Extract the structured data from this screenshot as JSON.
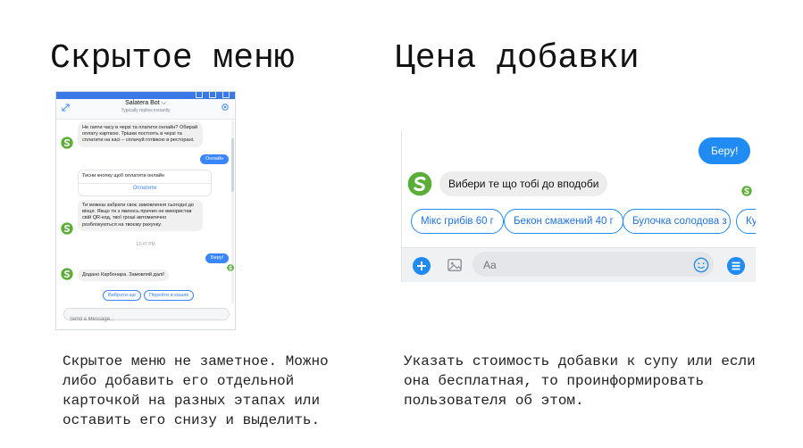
{
  "colors": {
    "accent": "#1f8bf3",
    "bot_logo_green": "#5aae37",
    "bubble_gray": "#f1f0f0"
  },
  "left": {
    "heading": "Скрытое меню",
    "caption": "Скрытое меню не заметное. Можно\nлибо добавить его отдельной\nкарточкой на разных этапах или\nоставить его снизу и выделить.",
    "window": {
      "bot_name": "Salatera Bot ⌵",
      "bot_status": "Typically replies instantly",
      "messages": {
        "m1": "Не гаяти часу в черзі та платити онлайн? Обирай оплату карткою. Трішки постоять в черзі та сплатити на касі – сплачуй готівкою в ресторані.",
        "u1": "Онлайн",
        "card_title": "Тисни кнопку щоб оплатити онлайн",
        "card_link": "Оплатити",
        "m2": "Ти можеш забрати своє замовлення сьогодні до вінця. Якщо ти з якихось причин не використав свій QR-код, твої гроші автоматично розблокуються на твоєму рахунку.",
        "time": "12:47 PM",
        "u2": "Беру!",
        "m3": "Додано Карбонара. Замовляй далі!"
      },
      "quick_replies": [
        "Вибрати ще",
        "Перейти в кошик"
      ],
      "composer_placeholder": "Send a Message..."
    }
  },
  "right": {
    "heading": "Цена добавки",
    "caption": "Указать стоимость добавки к супу или если\nона бесплатная, то проинформировать\nпользователя об этом.",
    "chat": {
      "user_message": "Беру!",
      "bot_message": "Вибери те що тобі до вподоби",
      "quick_replies": [
        "Мікс грибів 60 г",
        "Бекон смажений 40 г",
        "Булочка солодова з",
        "Ку"
      ],
      "composer_placeholder": "Aa"
    }
  }
}
